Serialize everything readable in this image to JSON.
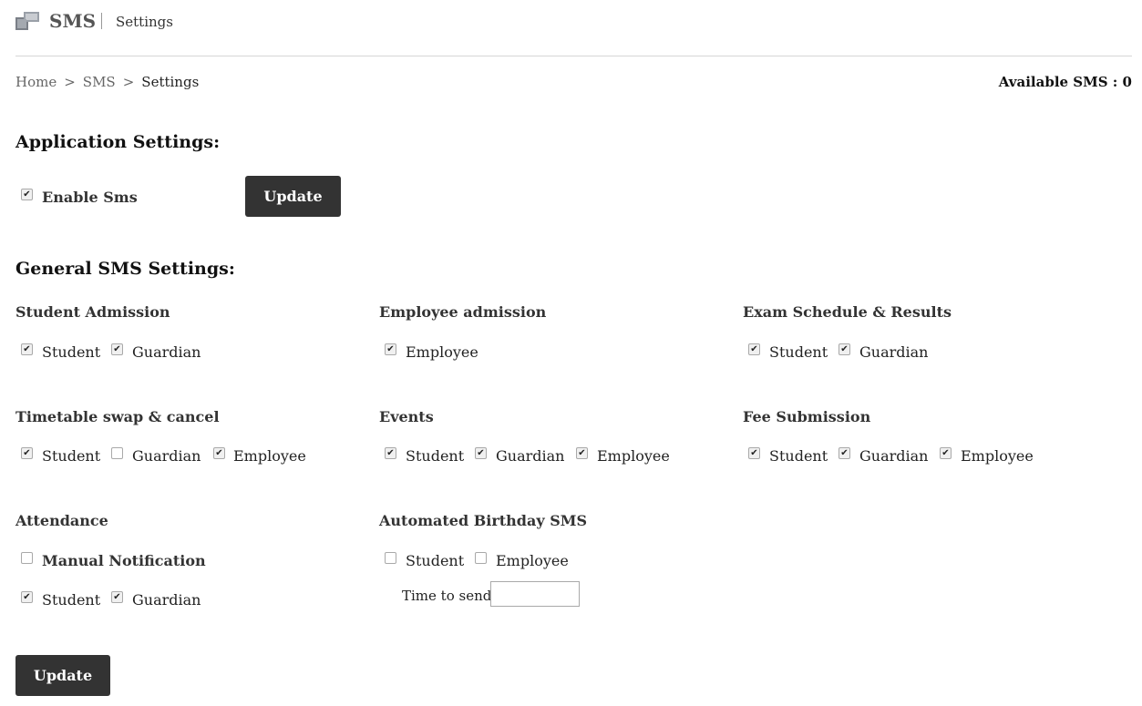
{
  "header": {
    "title": "SMS",
    "subtitle": "Settings",
    "icon": "sms-app-icon"
  },
  "breadcrumb": {
    "items": [
      "Home",
      "SMS",
      "Settings"
    ],
    "separator": ">"
  },
  "available_sms": "Available SMS : 0",
  "application_settings": {
    "heading": "Application Settings:",
    "enable_sms": {
      "label": "Enable Sms",
      "checked": true
    },
    "update_label": "Update"
  },
  "general": {
    "heading": "General SMS Settings:",
    "student_admission": {
      "title": "Student Admission",
      "options": [
        {
          "label": "Student",
          "checked": true
        },
        {
          "label": "Guardian",
          "checked": true
        }
      ]
    },
    "employee_admission": {
      "title": "Employee admission",
      "options": [
        {
          "label": "Employee",
          "checked": true
        }
      ]
    },
    "exam_schedule": {
      "title": "Exam Schedule & Results",
      "options": [
        {
          "label": "Student",
          "checked": true
        },
        {
          "label": "Guardian",
          "checked": true
        }
      ]
    },
    "timetable": {
      "title": "Timetable swap & cancel",
      "options": [
        {
          "label": "Student",
          "checked": true
        },
        {
          "label": "Guardian",
          "checked": false
        },
        {
          "label": "Employee",
          "checked": true
        }
      ]
    },
    "events": {
      "title": "Events",
      "options": [
        {
          "label": "Student",
          "checked": true
        },
        {
          "label": "Guardian",
          "checked": true
        },
        {
          "label": "Employee",
          "checked": true
        }
      ]
    },
    "fee_submission": {
      "title": "Fee Submission",
      "options": [
        {
          "label": "Student",
          "checked": true
        },
        {
          "label": "Guardian",
          "checked": true
        },
        {
          "label": "Employee",
          "checked": true
        }
      ]
    },
    "attendance": {
      "title": "Attendance",
      "manual_notification": {
        "label": "Manual Notification",
        "checked": false
      },
      "options": [
        {
          "label": "Student",
          "checked": true
        },
        {
          "label": "Guardian",
          "checked": true
        }
      ]
    },
    "birthday": {
      "title": "Automated Birthday SMS",
      "options": [
        {
          "label": "Student",
          "checked": false
        },
        {
          "label": "Employee",
          "checked": false
        }
      ],
      "time_label": "Time to send",
      "time_value": ""
    },
    "update_label": "Update"
  },
  "colors": {
    "button_bg": "#333333",
    "button_text": "#ffffff",
    "divider": "#d6d6d6"
  }
}
